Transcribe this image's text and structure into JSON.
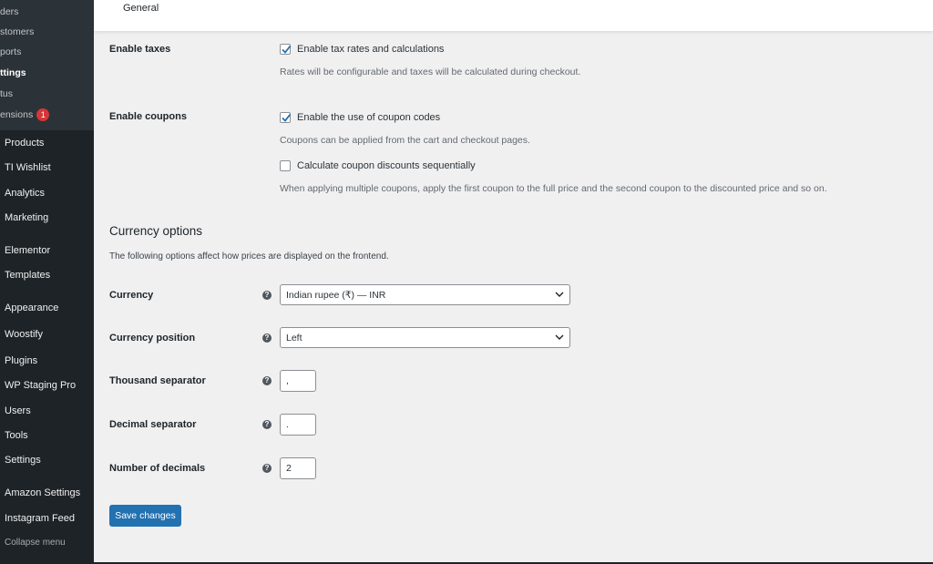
{
  "sidebar": {
    "submenu": [
      {
        "label": "Orders",
        "visible": "ders",
        "active": false
      },
      {
        "label": "Customers",
        "visible": "stomers",
        "active": false
      },
      {
        "label": "Reports",
        "visible": "ports",
        "active": false
      },
      {
        "label": "Settings",
        "visible": "ttings",
        "active": true
      },
      {
        "label": "Status",
        "visible": "tus",
        "active": false
      },
      {
        "label": "Extensions",
        "visible": "ensions",
        "badge": "1",
        "active": false
      }
    ],
    "menu": [
      {
        "label": "Products"
      },
      {
        "label": "TI Wishlist"
      },
      {
        "label": "Analytics"
      },
      {
        "label": "Marketing"
      },
      {
        "label": "Elementor"
      },
      {
        "label": "Templates"
      },
      {
        "label": "Appearance"
      },
      {
        "label": "Woostify"
      },
      {
        "label": "Plugins"
      },
      {
        "label": "WP Staging Pro"
      },
      {
        "label": "Users"
      },
      {
        "label": "Tools"
      },
      {
        "label": "Settings"
      },
      {
        "label": "Amazon Settings"
      },
      {
        "label": "Instagram Feed"
      }
    ],
    "collapse_label": "Collapse menu"
  },
  "topbar": {
    "tab_label": "General"
  },
  "taxes": {
    "label": "Enable taxes",
    "checkbox_label": "Enable tax rates and calculations",
    "checked": true,
    "description": "Rates will be configurable and taxes will be calculated during checkout."
  },
  "coupons": {
    "label": "Enable coupons",
    "checkbox_label": "Enable the use of coupon codes",
    "checked": true,
    "description": "Coupons can be applied from the cart and checkout pages.",
    "sequential_label": "Calculate coupon discounts sequentially",
    "sequential_checked": false,
    "sequential_description": "When applying multiple coupons, apply the first coupon to the full price and the second coupon to the discounted price and so on."
  },
  "currency_options": {
    "title": "Currency options",
    "description": "The following options affect how prices are displayed on the frontend.",
    "currency_label": "Currency",
    "currency_value": "Indian rupee (₹) — INR",
    "position_label": "Currency position",
    "position_value": "Left",
    "thousand_label": "Thousand separator",
    "thousand_value": ",",
    "decimal_label": "Decimal separator",
    "decimal_value": ".",
    "decimals_label": "Number of decimals",
    "decimals_value": "2"
  },
  "save_button": "Save changes",
  "help_glyph": "?",
  "colors": {
    "sidebar_bg": "#1d2327",
    "submenu_bg": "#2c3338",
    "primary": "#2271b1",
    "badge": "#d63638",
    "page_bg": "#f0f0f1"
  }
}
